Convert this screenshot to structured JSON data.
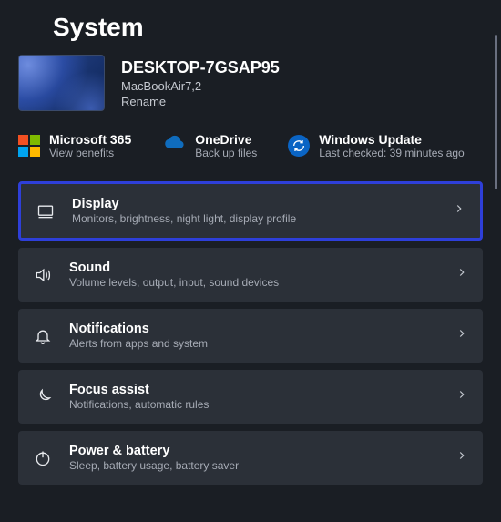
{
  "page": {
    "title": "System"
  },
  "device": {
    "name": "DESKTOP-7GSAP95",
    "model": "MacBookAir7,2",
    "rename_label": "Rename"
  },
  "quick": {
    "ms365": {
      "title": "Microsoft 365",
      "sub": "View benefits"
    },
    "onedrive": {
      "title": "OneDrive",
      "sub": "Back up files"
    },
    "update": {
      "title": "Windows Update",
      "sub": "Last checked: 39 minutes ago"
    }
  },
  "items": {
    "display": {
      "title": "Display",
      "sub": "Monitors, brightness, night light, display profile"
    },
    "sound": {
      "title": "Sound",
      "sub": "Volume levels, output, input, sound devices"
    },
    "notifications": {
      "title": "Notifications",
      "sub": "Alerts from apps and system"
    },
    "focus": {
      "title": "Focus assist",
      "sub": "Notifications, automatic rules"
    },
    "power": {
      "title": "Power & battery",
      "sub": "Sleep, battery usage, battery saver"
    }
  }
}
